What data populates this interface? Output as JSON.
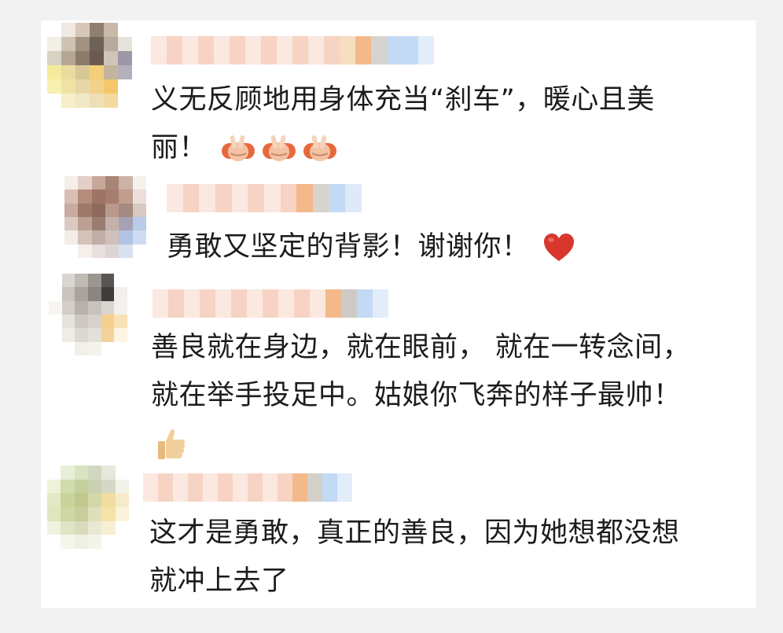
{
  "comments": [
    {
      "lines": [
        "义无反顾地用身体充当“刹车”，暖心且美",
        "丽！"
      ],
      "emoji_icon": "victory-hand-icon",
      "emoji_count": 3
    },
    {
      "lines": [
        "勇敢又坚定的背影！谢谢你！"
      ],
      "emoji_icon": "red-heart-icon",
      "emoji_count": 1
    },
    {
      "lines": [
        "善良就在身边，就在眼前， 就在一转念间，",
        "就在举手投足中。姑娘你飞奔的样子最帅！"
      ],
      "emoji_icon": "thumbs-up-icon",
      "emoji_count": 1
    },
    {
      "lines": [
        "这才是勇敢，真正的善良，因为她想都没想",
        "就冲上去了"
      ],
      "emoji_icon": "",
      "emoji_count": 0
    }
  ],
  "colors": {
    "page_background": "#f2f2f2",
    "panel_background": "#ffffff",
    "text": "#1c1c1c",
    "name_blur_pink": "#f7d3c3",
    "name_blur_orange": "#f3b98a",
    "name_blur_blue": "#c3daf5",
    "heart": "#d9362e"
  }
}
